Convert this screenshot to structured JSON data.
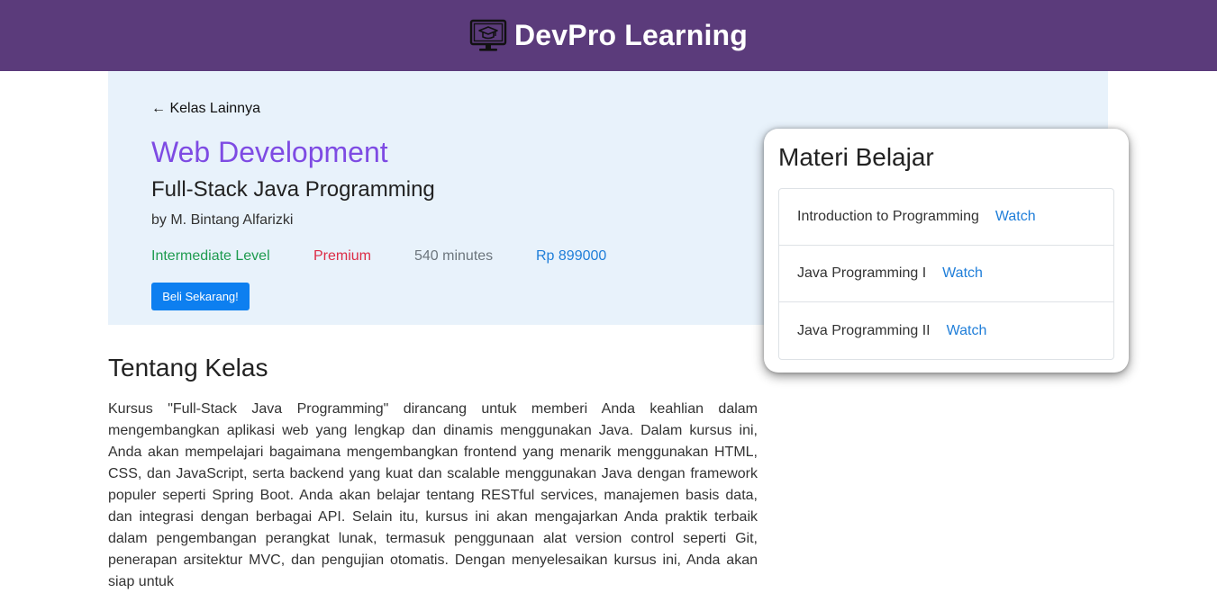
{
  "header": {
    "brand": "DevPro Learning",
    "icon": "computer-graduation-cap-icon",
    "background": "#5b3b7b"
  },
  "hero": {
    "back_link": "← Kelas Lainnya",
    "category": "Web Development",
    "title": "Full-Stack Java Programming",
    "author": "by M. Bintang Alfarizki",
    "level": "Intermediate Level",
    "tier": "Premium",
    "duration": "540 minutes",
    "price": "Rp 899000",
    "buy_button": "Beli Sekarang!",
    "colors": {
      "background": "#e8f2fb",
      "category": "#7e4be3",
      "level": "#1e9b4f",
      "tier": "#dc2b45",
      "price": "#1f7ed9",
      "button": "#0d7ff0"
    }
  },
  "about": {
    "heading": "Tentang Kelas",
    "text": "Kursus \"Full-Stack Java Programming\" dirancang untuk memberi Anda keahlian dalam mengembangkan aplikasi web yang lengkap dan dinamis menggunakan Java. Dalam kursus ini, Anda akan mempelajari bagaimana mengembangkan frontend yang menarik menggunakan HTML, CSS, dan JavaScript, serta backend yang kuat dan scalable menggunakan Java dengan framework populer seperti Spring Boot. Anda akan belajar tentang RESTful services, manajemen basis data, dan integrasi dengan berbagai API. Selain itu, kursus ini akan mengajarkan Anda praktik terbaik dalam pengembangan perangkat lunak, termasuk penggunaan alat version control seperti Git, penerapan arsitektur MVC, dan pengujian otomatis. Dengan menyelesaikan kursus ini, Anda akan siap untuk"
  },
  "materi": {
    "title": "Materi Belajar",
    "items": [
      {
        "name": "Introduction to Programming",
        "action": "Watch"
      },
      {
        "name": "Java Programming I",
        "action": "Watch"
      },
      {
        "name": "Java Programming II",
        "action": "Watch"
      }
    ]
  }
}
